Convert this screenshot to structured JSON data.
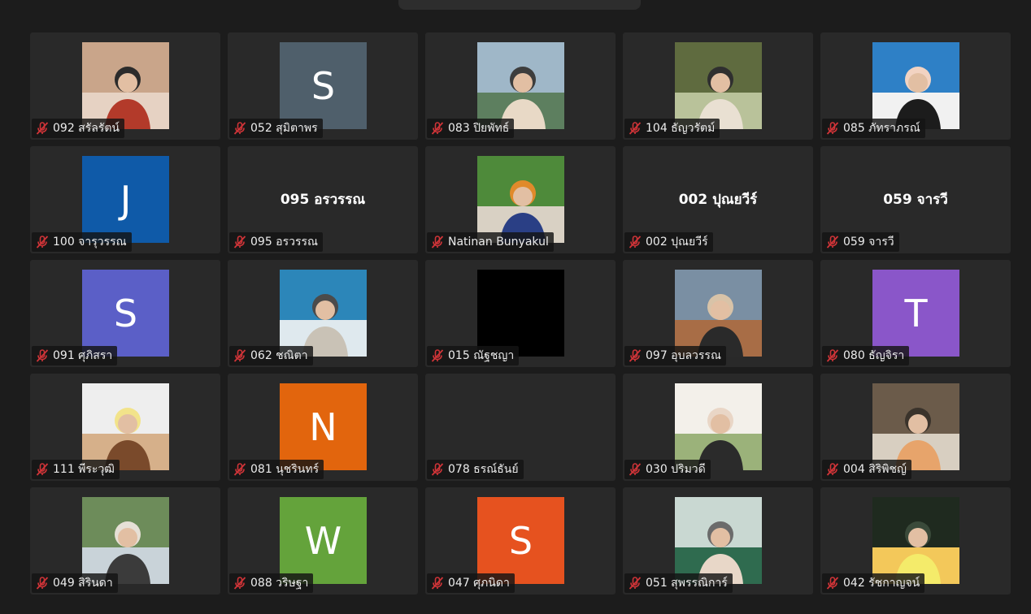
{
  "colors": {
    "background": "#1c1c1c",
    "tile": "#292929",
    "muted_icon": "#d13438"
  },
  "participants": [
    {
      "name": "092 สรัลรัตน์",
      "avatar": "photo",
      "muted": true
    },
    {
      "name": "052 สุมิตาพร",
      "avatar": "initial",
      "initial": "S",
      "color": "#4f5f6b",
      "muted": true
    },
    {
      "name": "083 ปิยพัทธ์",
      "avatar": "photo",
      "muted": true
    },
    {
      "name": "104 ธัญวรัตม์",
      "avatar": "photo",
      "muted": true
    },
    {
      "name": "085 ภัทราภรณ์",
      "avatar": "photo",
      "muted": true
    },
    {
      "name": "100 จารุวรรณ",
      "avatar": "initial",
      "initial": "J",
      "color": "#0f5aa8",
      "muted": true
    },
    {
      "name": "095 อรวรรณ",
      "avatar": "text",
      "display_name": "095 อรวรรณ",
      "muted": true
    },
    {
      "name": "Natinan Bunyakul",
      "avatar": "photo",
      "muted": true
    },
    {
      "name": "002 ปุณยวีร์",
      "avatar": "text",
      "display_name": "002 ปุณยวีร์",
      "muted": true
    },
    {
      "name": "059 จารวี",
      "avatar": "text",
      "display_name": "059 จารวี",
      "muted": true
    },
    {
      "name": "091 ศุภิสรา",
      "avatar": "initial",
      "initial": "S",
      "color": "#5b5fc7",
      "muted": true
    },
    {
      "name": "062 ชณิตา",
      "avatar": "photo",
      "muted": true
    },
    {
      "name": "015 ณัฐชญา",
      "avatar": "black",
      "muted": true
    },
    {
      "name": "097 อุบลวรรณ",
      "avatar": "photo",
      "muted": true
    },
    {
      "name": "080 ธัญจิรา",
      "avatar": "initial",
      "initial": "T",
      "color": "#8a56c9",
      "muted": true
    },
    {
      "name": "111 พีระวุฒิ",
      "avatar": "photo",
      "muted": true
    },
    {
      "name": "081 นุชรินทร์",
      "avatar": "initial",
      "initial": "N",
      "color": "#e2650d",
      "muted": true
    },
    {
      "name": "078 ธรณ์ธันย์",
      "avatar": "none",
      "muted": true
    },
    {
      "name": "030 ปริมวดี",
      "avatar": "photo",
      "muted": true
    },
    {
      "name": "004 สิริพิชญ์",
      "avatar": "photo",
      "muted": true
    },
    {
      "name": "049 สิรินดา",
      "avatar": "photo",
      "muted": true
    },
    {
      "name": "088 วริษฐา",
      "avatar": "initial",
      "initial": "W",
      "color": "#64a33b",
      "muted": true
    },
    {
      "name": "047 ศุภนิดา",
      "avatar": "initial",
      "initial": "S",
      "color": "#e6521f",
      "muted": true
    },
    {
      "name": "051 สุพรรณิการ์",
      "avatar": "photo",
      "muted": true
    },
    {
      "name": "042 รัชกาญจน์",
      "avatar": "photo",
      "muted": true
    }
  ]
}
